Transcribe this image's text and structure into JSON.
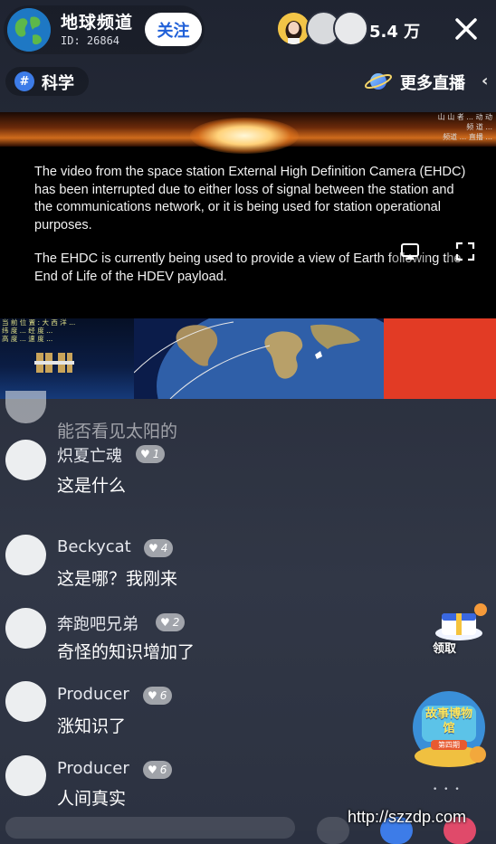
{
  "header": {
    "channel_name": "地球频道",
    "channel_id": "ID: 26864",
    "follow_label": "关注",
    "viewer_count": "5.4 万"
  },
  "category": {
    "icon_glyph": "#",
    "label": "科学"
  },
  "more_live": {
    "label": "更多直播",
    "chevron": "‹"
  },
  "video": {
    "watermark": "山 山 者 ... 动 动 频 道 ...\n频道 ... 直播 ...",
    "notice_p1": "The video from the space station External High Definition Camera (EHDC) has been interrupted due to either loss of signal between the station and the communications network, or it is being used for station operational purposes.",
    "notice_p2": "The EHDC is currently being used to provide a view of Earth following the End of Life of the HDEV payload.",
    "overlay_text": "当 前 位 置 : 大 西 洋 ...\n纬 度 ... 经 度 ...\n高 度 ... 速 度 ..."
  },
  "comments": [
    {
      "name": "",
      "badge": "",
      "text": "能否看见太阳的",
      "faded": true
    },
    {
      "name": "炽夏亡魂",
      "badge": "1",
      "text": "这是什么",
      "faded": false
    },
    {
      "name": "Beckycat",
      "badge": "4",
      "text": "这是哪？我刚来",
      "faded": false
    },
    {
      "name": "奔跑吧兄弟",
      "badge": "2",
      "text": "奇怪的知识增加了",
      "faded": false
    },
    {
      "name": "Producer",
      "badge": "6",
      "text": "涨知识了",
      "faded": false
    },
    {
      "name": "Producer",
      "badge": "6",
      "text": "人间真实",
      "faded": false
    }
  ],
  "widgets": {
    "gift_label": "领取",
    "museum_title": "故事博物馆",
    "museum_sub": "第四期",
    "dots": "• • •"
  },
  "watermark": "http://szzdp.com",
  "colors": {
    "follow_text": "#2060d8",
    "category_icon_bg": "#3d7ce8",
    "video_red_panel": "#e23b25",
    "earth_ocean": "#2f5fa8"
  }
}
